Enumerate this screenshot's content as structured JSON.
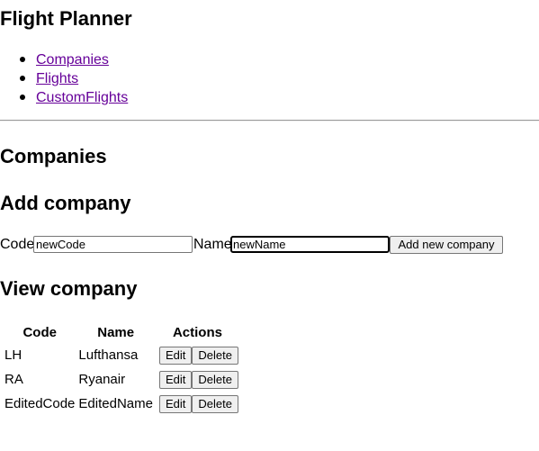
{
  "app": {
    "title": "Flight Planner"
  },
  "nav": {
    "items": [
      {
        "label": "Companies"
      },
      {
        "label": "Flights"
      },
      {
        "label": "CustomFlights"
      }
    ]
  },
  "page": {
    "heading": "Companies"
  },
  "add_form": {
    "heading": "Add company",
    "code_label": "Code",
    "code_value": "newCode",
    "name_label": "Name",
    "name_value": "newName",
    "submit_label": "Add new company"
  },
  "view": {
    "heading": "View company",
    "columns": [
      "Code",
      "Name",
      "Actions"
    ],
    "rows": [
      {
        "code": "LH",
        "name": "Lufthansa",
        "edit": "Edit",
        "delete": "Delete"
      },
      {
        "code": "RA",
        "name": "Ryanair",
        "edit": "Edit",
        "delete": "Delete"
      },
      {
        "code": "EditedCode",
        "name": "EditedName",
        "edit": "Edit",
        "delete": "Delete"
      }
    ]
  },
  "colors": {
    "visited_link": "#660099",
    "button_bg": "#efefef",
    "button_border": "#767676",
    "rule": "#9a9a9a"
  }
}
